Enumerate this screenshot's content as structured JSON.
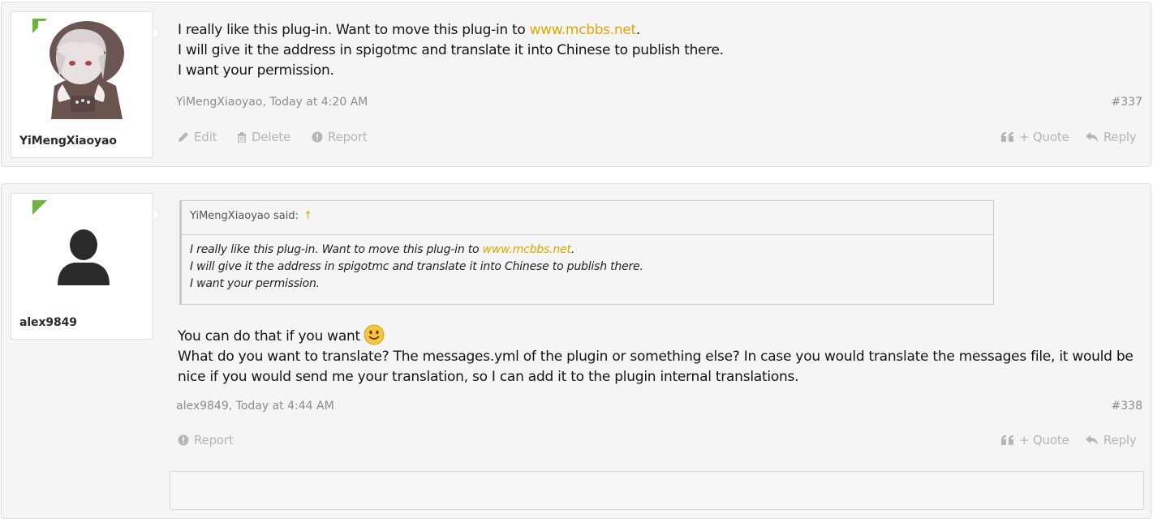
{
  "posts": [
    {
      "username": "YiMengXiaoyao",
      "message": {
        "line1_pre": "I really like this plug-in. Want to move this plug-in to ",
        "link": "www.mcbbs.net",
        "line1_post": ".",
        "line2": "I will give it the address in spigotmc and translate it into Chinese to publish there.",
        "line3": "I want your permission."
      },
      "meta": "YiMengXiaoyao, Today at 4:20 AM",
      "number": "#337",
      "actions": {
        "edit": "Edit",
        "delete": "Delete",
        "report": "Report",
        "quote": "+ Quote",
        "reply": "Reply"
      }
    },
    {
      "username": "alex9849",
      "quote": {
        "attribution": "YiMengXiaoyao said:",
        "arrow": "↑",
        "line1_pre": "I really like this plug-in. Want to move this plug-in to ",
        "link": "www.mcbbs.net",
        "line1_post": ".",
        "line2": "I will give it the address in spigotmc and translate it into Chinese to publish there.",
        "line3": "I want your permission."
      },
      "message": {
        "line1": "You can do that if you want",
        "line2": "What do you want to translate? The messages.yml of the plugin or something else? In case you would translate the messages file, it would be",
        "line3": "nice if you would send me your translation, so I can add it to the plugin internal translations."
      },
      "meta": "alex9849, Today at 4:44 AM",
      "number": "#338",
      "actions": {
        "report": "Report",
        "quote": "+ Quote",
        "reply": "Reply"
      }
    }
  ],
  "colors": {
    "link": "#e0a700",
    "online": "#6cb33f",
    "muted": "#b5b5b5"
  },
  "icons": [
    "pencil-icon",
    "trash-icon",
    "alert-icon",
    "quote-icon",
    "reply-icon",
    "smiley-icon",
    "online-badge-icon",
    "default-avatar-icon"
  ]
}
